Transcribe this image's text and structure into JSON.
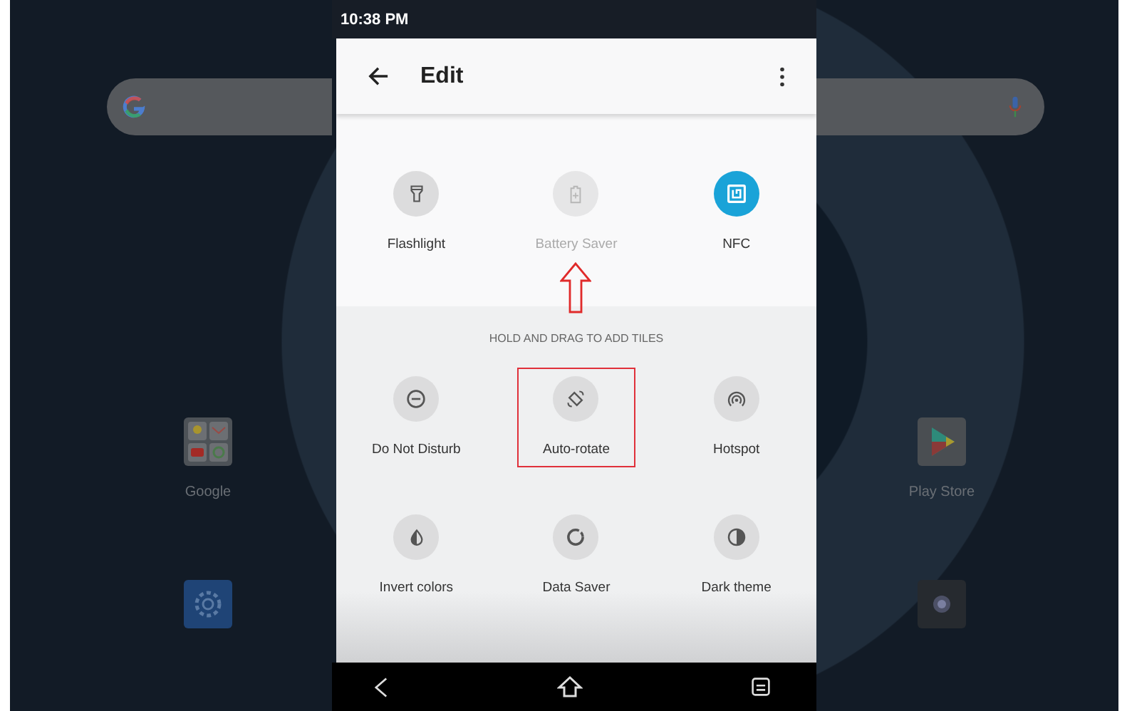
{
  "status_bar": {
    "time": "10:38 PM"
  },
  "toolbar": {
    "title": "Edit"
  },
  "active_tiles": [
    {
      "label": "Flashlight",
      "kind": "flashlight",
      "on": false,
      "disabled": false,
      "arrowed": false
    },
    {
      "label": "Battery Saver",
      "kind": "battery",
      "on": false,
      "disabled": true,
      "arrowed": true
    },
    {
      "label": "NFC",
      "kind": "nfc",
      "on": true,
      "disabled": false,
      "arrowed": false
    }
  ],
  "hint": "HOLD AND DRAG TO ADD TILES",
  "available_tiles": [
    {
      "label": "Do Not Disturb",
      "kind": "dnd",
      "boxed": false
    },
    {
      "label": "Auto-rotate",
      "kind": "rotate",
      "boxed": true
    },
    {
      "label": "Hotspot",
      "kind": "hotspot",
      "boxed": false
    },
    {
      "label": "Invert colors",
      "kind": "invert",
      "boxed": false
    },
    {
      "label": "Data Saver",
      "kind": "datasaver",
      "boxed": false
    },
    {
      "label": "Dark theme",
      "kind": "dark",
      "boxed": false
    }
  ],
  "home_left": {
    "apps": [
      {
        "kind": "folder",
        "label": "Google"
      },
      {
        "kind": "settings"
      }
    ]
  },
  "home_right": {
    "apps": [
      {
        "kind": "store",
        "label": "Play Store"
      },
      {
        "kind": "camera"
      }
    ]
  }
}
